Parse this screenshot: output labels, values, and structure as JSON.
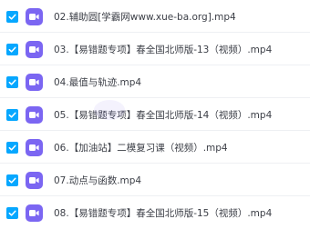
{
  "files": [
    {
      "name": "02.辅助圆[学霸网www.xue-ba.org].mp4",
      "checked": true
    },
    {
      "name": "03.【易错题专项】春全国北师版-13（视频）.mp4",
      "checked": true
    },
    {
      "name": "04.最值与轨迹.mp4",
      "checked": true
    },
    {
      "name": "05.【易错题专项】春全国北师版-14（视频）.mp4",
      "checked": true
    },
    {
      "name": "06.【加油站】二模复习课（视频）.mp4",
      "checked": true
    },
    {
      "name": "07.动点与函数.mp4",
      "checked": true
    },
    {
      "name": "08.【易错题专项】春全国北师版-15（视频）.mp4",
      "checked": true
    }
  ],
  "icons": {
    "checkbox": "checkmark-icon",
    "file": "video-file-icon"
  },
  "colors": {
    "accent": "#06a7ff",
    "video_icon": "#7b66f2",
    "text": "#3b3e46",
    "divider": "#eef0f3"
  }
}
